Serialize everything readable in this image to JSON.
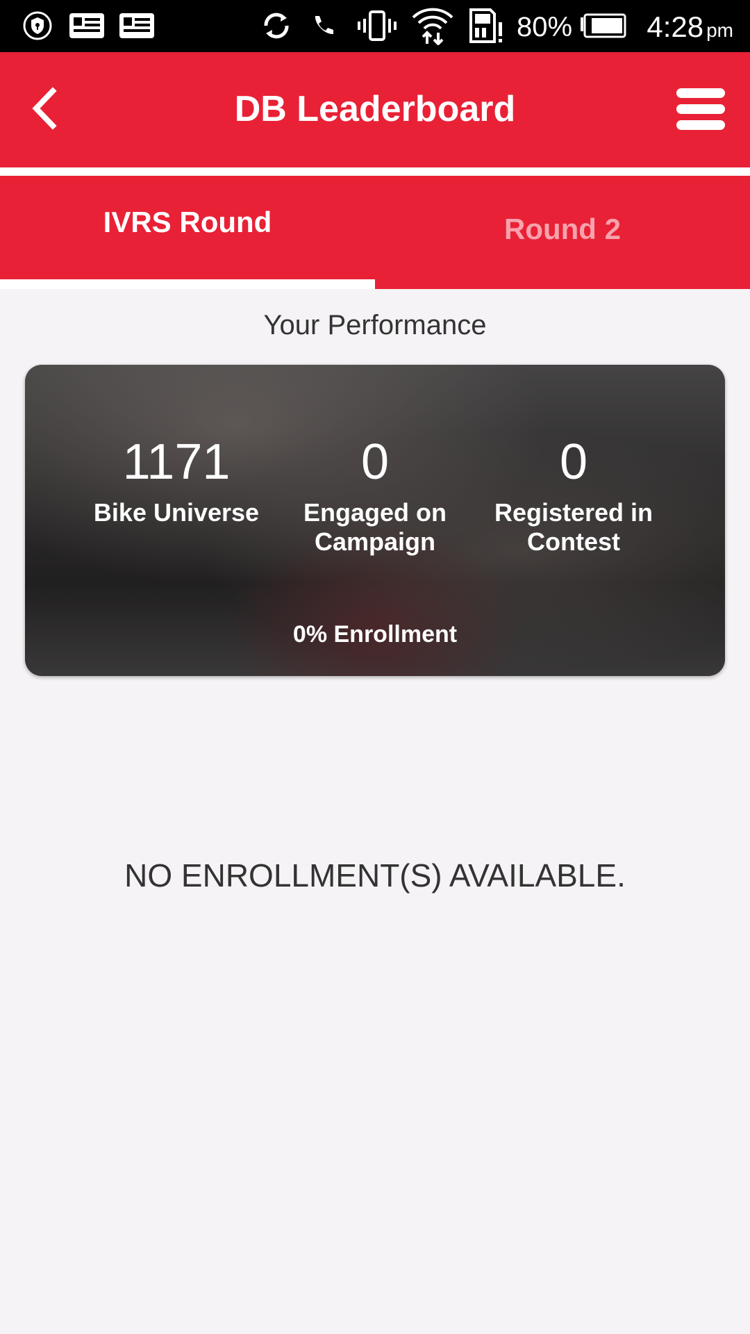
{
  "status_bar": {
    "battery_percent": "80%",
    "time": "4:28",
    "time_suffix": "pm",
    "icons": [
      "shield-icon",
      "news-icon",
      "news-icon",
      "sync-icon",
      "call-icon",
      "vibrate-icon",
      "wifi-icon",
      "sd-card-alert-icon",
      "battery-icon"
    ]
  },
  "app_bar": {
    "title": "DB Leaderboard",
    "back_icon": "chevron-left-icon",
    "menu_icon": "menu-icon"
  },
  "tabs": [
    {
      "label": "IVRS Round",
      "active": true
    },
    {
      "label": "Round 2",
      "active": false
    }
  ],
  "section_title": "Your Performance",
  "performance": {
    "stats": [
      {
        "value": "1171",
        "label": "Bike Universe"
      },
      {
        "value": "0",
        "label": "Engaged on Campaign"
      },
      {
        "value": "0",
        "label": "Registered in Contest"
      }
    ],
    "enrollment_text": "0% Enrollment"
  },
  "empty_message": "NO ENROLLMENT(S) AVAILABLE.",
  "colors": {
    "primary": "#e92136",
    "inactive_tab_text": "#f7a2ad",
    "background": "#f5f3f5"
  }
}
